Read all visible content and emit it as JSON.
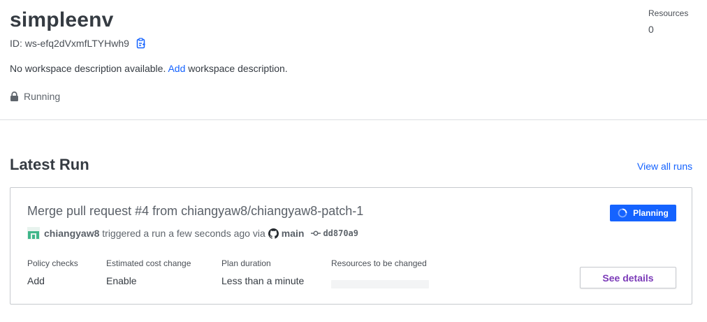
{
  "workspace": {
    "name": "simpleenv",
    "id_label": "ID: ws-efq2dVxmfLTYHwh9",
    "description_prefix": "No workspace description available.",
    "description_link": "Add",
    "description_suffix": "workspace description.",
    "status": "Running",
    "resources_label": "Resources",
    "resources_value": "0"
  },
  "latest_run": {
    "heading": "Latest Run",
    "view_all": "View all runs",
    "title": "Merge pull request #4 from chiangyaw8/chiangyaw8-patch-1",
    "status_badge": "Planning",
    "user": "chiangyaw8",
    "trigger_text": "triggered a run a few seconds ago via",
    "branch": "main",
    "commit": "dd870a9",
    "columns": [
      {
        "label": "Policy checks",
        "value": "Add"
      },
      {
        "label": "Estimated cost change",
        "value": "Enable"
      },
      {
        "label": "Plan duration",
        "value": "Less than a minute"
      },
      {
        "label": "Resources to be changed",
        "value": ""
      }
    ],
    "details_button": "See details"
  },
  "colors": {
    "link": "#1563ff",
    "badge_bg": "#1563ff",
    "details_text": "#7b3ab8",
    "avatar": "#3fb68a"
  }
}
